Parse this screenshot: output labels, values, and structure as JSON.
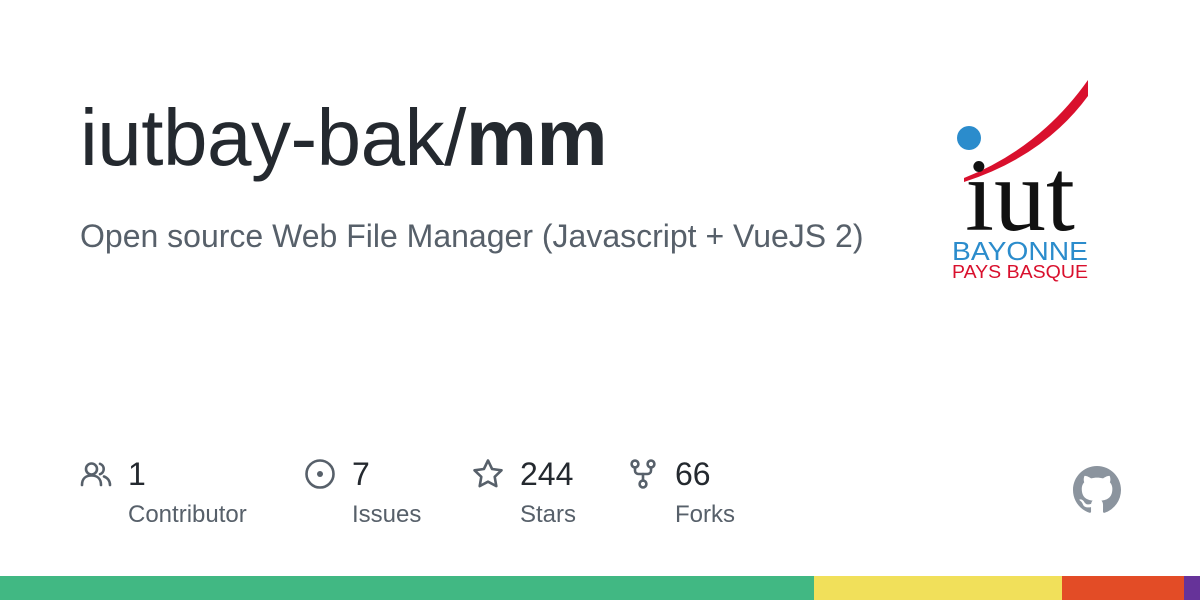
{
  "repo": {
    "owner": "iutbay-bak/",
    "name": "mm",
    "description": "Open source Web File Manager (Javascript + VueJS 2)"
  },
  "logo": {
    "mark": "iut",
    "line1": "BAYONNE",
    "line2": "PAYS BASQUE",
    "colors": {
      "text": "#111111",
      "blue": "#2b8ccc",
      "red": "#d9102d"
    }
  },
  "stats": [
    {
      "icon": "people-icon",
      "value": "1",
      "label": "Contributor"
    },
    {
      "icon": "issue-icon",
      "value": "7",
      "label": "Issues"
    },
    {
      "icon": "star-icon",
      "value": "244",
      "label": "Stars"
    },
    {
      "icon": "fork-icon",
      "value": "66",
      "label": "Forks"
    }
  ],
  "icons": {
    "brand": "github-mark-icon",
    "color": "#57606a",
    "brand_color": "#8b949e"
  },
  "languages": [
    {
      "share": 67.8,
      "color": "#41b883"
    },
    {
      "share": 20.7,
      "color": "#f1e05a"
    },
    {
      "share": 10.2,
      "color": "#e34c26"
    },
    {
      "share": 1.3,
      "color": "#663399"
    }
  ]
}
